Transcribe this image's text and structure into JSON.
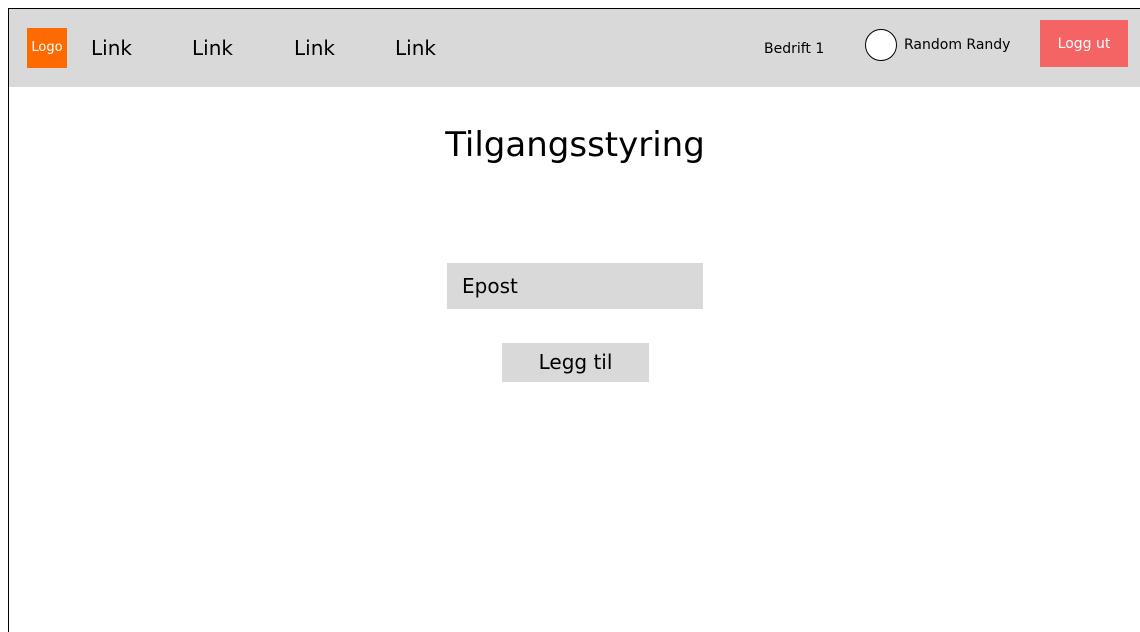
{
  "header": {
    "logo_text": "Logo",
    "links": [
      "Link",
      "Link",
      "Link",
      "Link"
    ],
    "company": "Bedrift 1",
    "user_name": "Random Randy",
    "logout_label": "Logg ut"
  },
  "main": {
    "title": "Tilgangsstyring",
    "email_placeholder": "Epost",
    "add_button_label": "Legg til"
  },
  "colors": {
    "header_bg": "#d9d9d9",
    "logo_bg": "#ff6a00",
    "logout_bg": "#f56464"
  }
}
